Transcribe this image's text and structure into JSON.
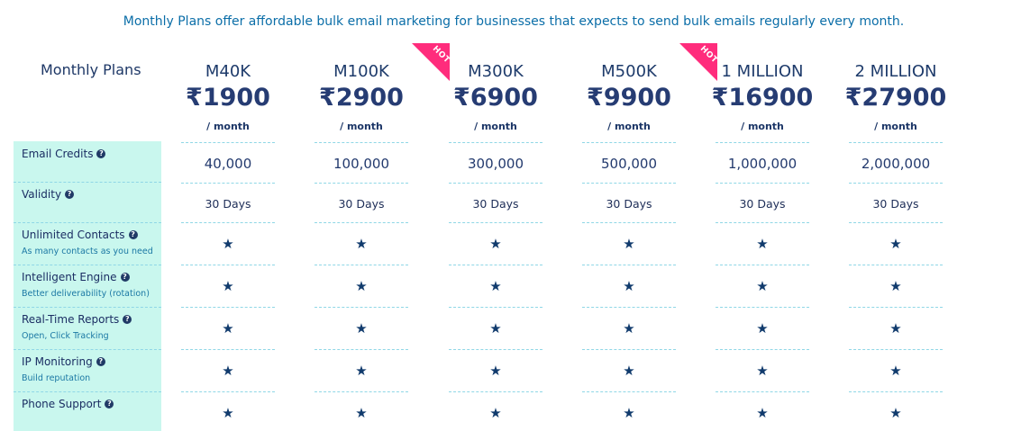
{
  "intro_text": "Monthly Plans offer affordable bulk email marketing for businesses that expects to send bulk emails regularly every month.",
  "side_title": "Monthly Plans",
  "help_icon": "question-circle-icon",
  "star_icon": "star-icon",
  "hot_badge_label": "HOT",
  "features": [
    {
      "name": "Email Credits",
      "sub": ""
    },
    {
      "name": "Validity",
      "sub": ""
    },
    {
      "name": "Unlimited Contacts",
      "sub": "As many contacts as you need"
    },
    {
      "name": "Intelligent Engine",
      "sub": "Better deliverability (rotation)"
    },
    {
      "name": "Real-Time Reports",
      "sub": "Open, Click Tracking"
    },
    {
      "name": "IP Monitoring",
      "sub": "Build reputation"
    },
    {
      "name": "Phone Support",
      "sub": ""
    }
  ],
  "plans": [
    {
      "name": "M40K",
      "price": "₹1900",
      "per": "/ month",
      "credits": "40,000",
      "validity": "30 Days",
      "hot": false
    },
    {
      "name": "M100K",
      "price": "₹2900",
      "per": "/ month",
      "credits": "100,000",
      "validity": "30 Days",
      "hot": true
    },
    {
      "name": "M300K",
      "price": "₹6900",
      "per": "/ month",
      "credits": "300,000",
      "validity": "30 Days",
      "hot": false
    },
    {
      "name": "M500K",
      "price": "₹9900",
      "per": "/ month",
      "credits": "500,000",
      "validity": "30 Days",
      "hot": true
    },
    {
      "name": "1 MILLION",
      "price": "₹16900",
      "per": "/ month",
      "credits": "1,000,000",
      "validity": "30 Days",
      "hot": false
    },
    {
      "name": "2 MILLION",
      "price": "₹27900",
      "per": "/ month",
      "credits": "2,000,000",
      "validity": "30 Days",
      "hot": false
    }
  ],
  "colors": {
    "accent": "#0b6ea8",
    "feature_panel": "#c9f7ee",
    "hot_badge": "#ff2c7c",
    "star": "#113b6d"
  }
}
